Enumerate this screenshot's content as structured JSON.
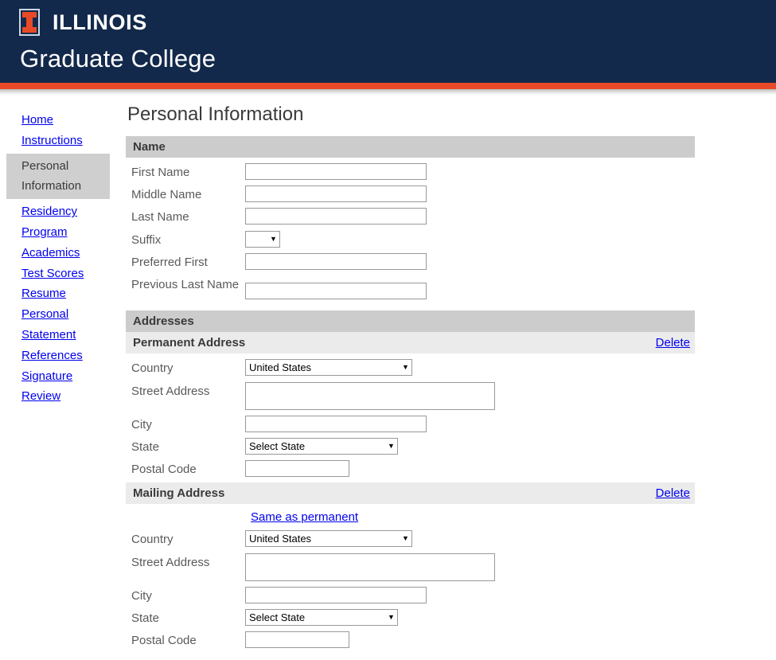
{
  "masthead": {
    "logo_icon": "illinois-block-i-icon",
    "wordmark": "ILLINOIS",
    "unit": "Graduate College",
    "navy": "#13294B",
    "orange": "#E84A27"
  },
  "sidebar": {
    "items": [
      {
        "label": "Home",
        "active": false
      },
      {
        "label": "Instructions",
        "active": false
      },
      {
        "label": "Personal Information",
        "active": true
      },
      {
        "label": "Residency",
        "active": false
      },
      {
        "label": "Program",
        "active": false
      },
      {
        "label": "Academics",
        "active": false
      },
      {
        "label": "Test Scores",
        "active": false
      },
      {
        "label": "Resume",
        "active": false
      },
      {
        "label": "Personal Statement",
        "active": false
      },
      {
        "label": "References",
        "active": false
      },
      {
        "label": "Signature",
        "active": false
      },
      {
        "label": "Review",
        "active": false
      }
    ]
  },
  "main": {
    "title": "Personal Information",
    "name_section": {
      "header": "Name",
      "fields": {
        "first_name_label": "First Name",
        "first_name_value": "",
        "middle_name_label": "Middle Name",
        "middle_name_value": "",
        "last_name_label": "Last Name",
        "last_name_value": "",
        "suffix_label": "Suffix",
        "suffix_value": "",
        "preferred_first_label": "Preferred First",
        "preferred_first_value": "",
        "previous_last_label": "Previous Last Name",
        "previous_last_value": ""
      }
    },
    "addresses_section": {
      "header": "Addresses",
      "permanent": {
        "header": "Permanent Address",
        "delete_label": "Delete",
        "country_label": "Country",
        "country_value": "United States",
        "street_label": "Street Address",
        "street_value": "",
        "city_label": "City",
        "city_value": "",
        "state_label": "State",
        "state_value": "Select State",
        "postal_label": "Postal Code",
        "postal_value": ""
      },
      "mailing": {
        "header": "Mailing Address",
        "delete_label": "Delete",
        "same_as_permanent_label": "Same as permanent",
        "country_label": "Country",
        "country_value": "United States",
        "street_label": "Street Address",
        "street_value": "",
        "city_label": "City",
        "city_value": "",
        "state_label": "State",
        "state_value": "Select State",
        "postal_label": "Postal Code",
        "postal_value": ""
      }
    }
  }
}
